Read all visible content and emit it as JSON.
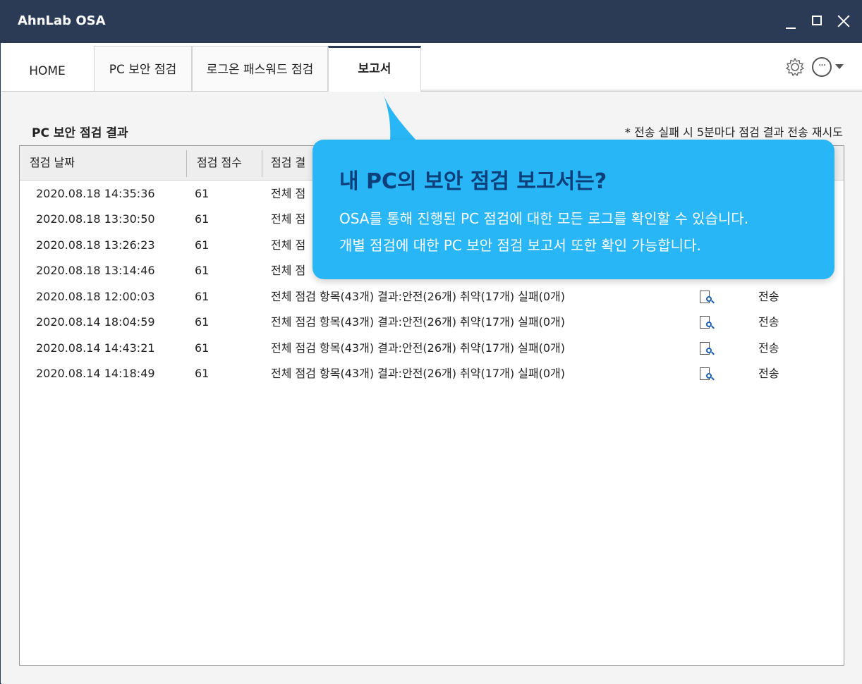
{
  "window": {
    "title": "AhnLab OSA"
  },
  "tabs": [
    {
      "label": "HOME"
    },
    {
      "label": "PC 보안 점검"
    },
    {
      "label": "로그온 패스워드 점검"
    },
    {
      "label": "보고서"
    }
  ],
  "section": {
    "title": "PC 보안 점검 결과",
    "note": "* 전송 실패 시 5분마다 점검 결과 전송 재시도"
  },
  "table": {
    "headers": [
      "점검 날짜",
      "점검 점수",
      "점검 결"
    ],
    "rows": [
      {
        "date": "2020.08.18 14:35:36",
        "score": "61",
        "result": "전체 점",
        "send": ""
      },
      {
        "date": "2020.08.18 13:30:50",
        "score": "61",
        "result": "전체 점",
        "send": ""
      },
      {
        "date": "2020.08.18 13:26:23",
        "score": "61",
        "result": "전체 점",
        "send": ""
      },
      {
        "date": "2020.08.18 13:14:46",
        "score": "61",
        "result": "전체 점",
        "send": ""
      },
      {
        "date": "2020.08.18 12:00:03",
        "score": "61",
        "result": "전체 점검 항목(43개) 결과:안전(26개) 취약(17개) 실패(0개)",
        "send": "전송"
      },
      {
        "date": "2020.08.14 18:04:59",
        "score": "61",
        "result": "전체 점검 항목(43개) 결과:안전(26개) 취약(17개) 실패(0개)",
        "send": "전송"
      },
      {
        "date": "2020.08.14 14:43:21",
        "score": "61",
        "result": "전체 점검 항목(43개) 결과:안전(26개) 취약(17개) 실패(0개)",
        "send": "전송"
      },
      {
        "date": "2020.08.14 14:18:49",
        "score": "61",
        "result": "전체 점검 항목(43개) 결과:안전(26개) 취약(17개) 실패(0개)",
        "send": "전송"
      }
    ]
  },
  "callout": {
    "title": "내 PC의 보안 점검 보고서는?",
    "line1": "OSA를 통해 진행된 PC 점검에 대한 모든 로그를 확인할 수 있습니다.",
    "line2": "개별 점검에 대한 PC 보안 점검 보고서 또한 확인 가능합니다."
  },
  "icons": {
    "settings": "gear-icon",
    "more": "more-options-icon",
    "dropdown": "chevron-down-icon",
    "view_report": "report-view-icon"
  },
  "colors": {
    "titlebar": "#2b3a55",
    "callout_bg": "#29b6f6",
    "callout_title": "#0d3f7a"
  }
}
